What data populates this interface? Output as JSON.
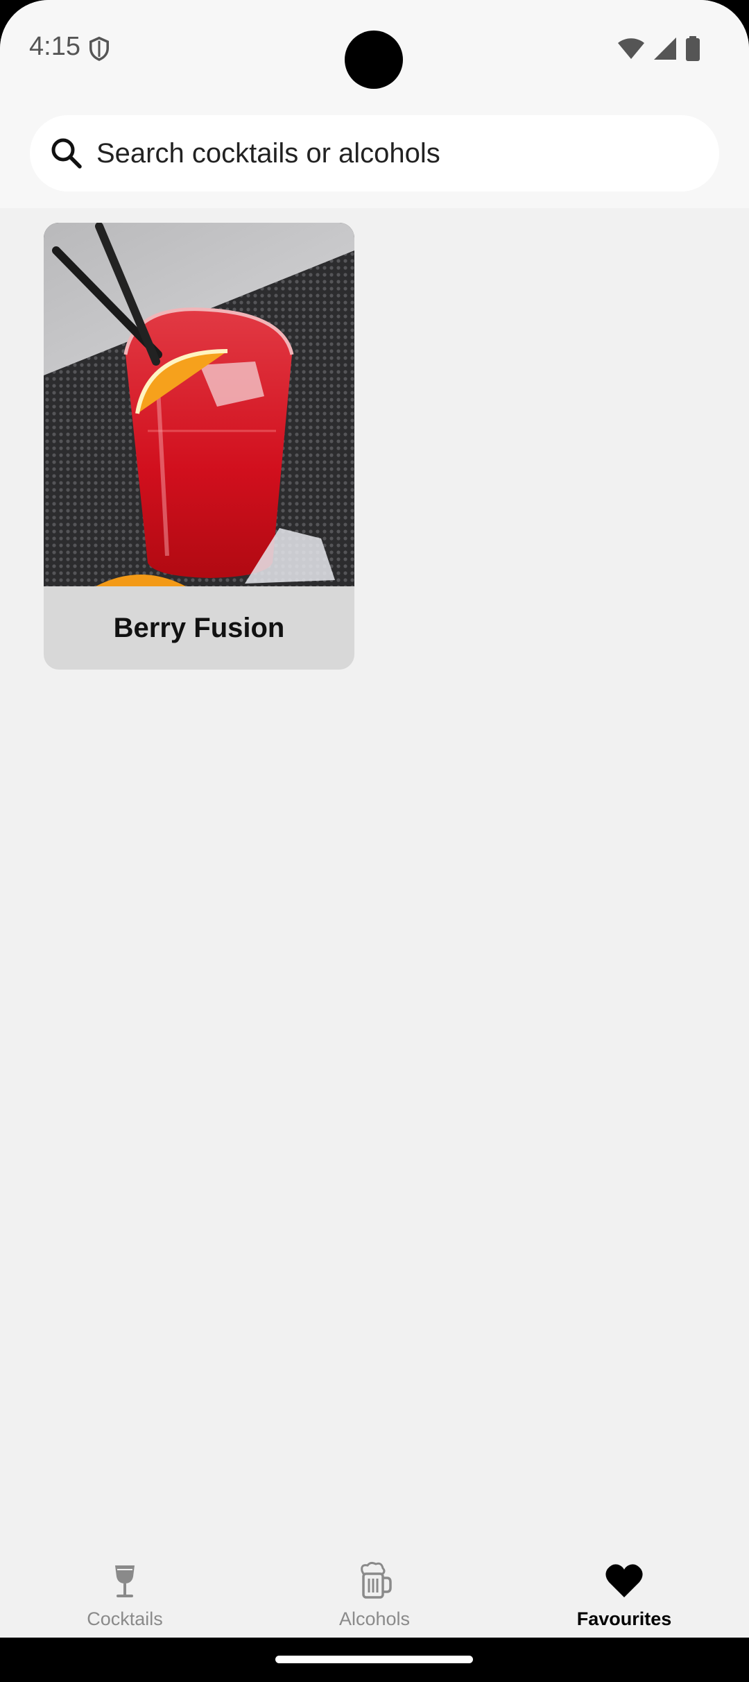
{
  "status_bar": {
    "time": "4:15",
    "icons": [
      "shield-icon",
      "wifi-icon",
      "signal-icon",
      "battery-icon"
    ]
  },
  "search": {
    "placeholder": "Search cocktails or alcohols",
    "value": ""
  },
  "favourites": [
    {
      "name": "Berry Fusion",
      "image": "red cocktail in glass with orange slice and straws"
    }
  ],
  "bottom_nav": {
    "items": [
      {
        "label": "Cocktails",
        "icon": "cocktail-glass-icon",
        "active": false
      },
      {
        "label": "Alcohols",
        "icon": "beer-mug-icon",
        "active": false
      },
      {
        "label": "Favourites",
        "icon": "heart-icon",
        "active": true
      }
    ]
  },
  "colors": {
    "background": "#f1f1f1",
    "header": "#f7f7f7",
    "card_footer": "#d8d8d8",
    "nav_inactive": "#8a8a8a",
    "nav_active": "#000000"
  }
}
